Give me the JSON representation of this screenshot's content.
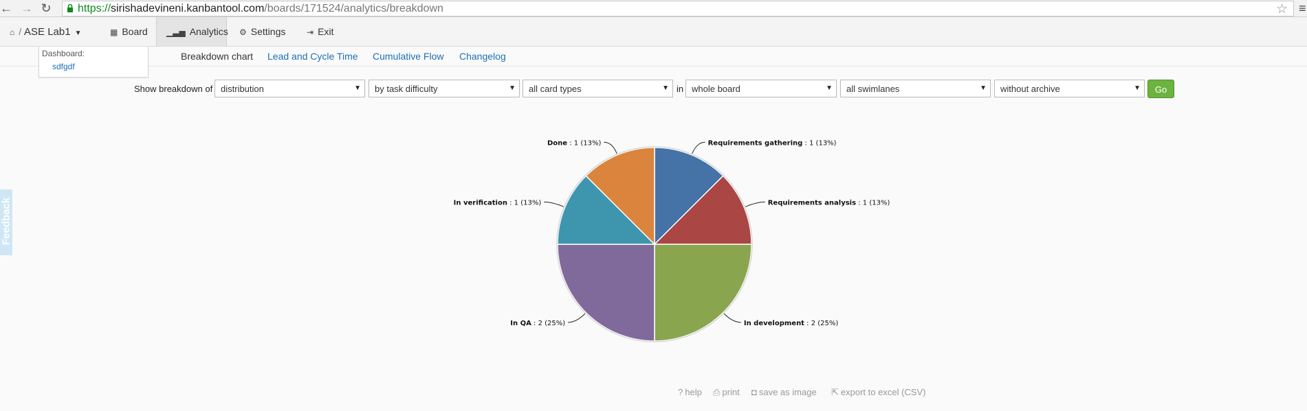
{
  "browser": {
    "url_scheme": "https://",
    "url_host": "sirishadevineni.kanbantool.com",
    "url_path": "/boards/171524/analytics/breakdown"
  },
  "app_nav": {
    "board_name": "ASE Lab1",
    "items": [
      {
        "label": "Board",
        "icon": "board-icon"
      },
      {
        "label": "Analytics",
        "icon": "chart-bars-icon",
        "active": true
      },
      {
        "label": "Settings",
        "icon": "gear-icon"
      },
      {
        "label": "Exit",
        "icon": "exit-icon"
      }
    ]
  },
  "dashboard": {
    "label": "Dashboard:",
    "link": "sdfgdf"
  },
  "subnav": {
    "current": "Breakdown chart",
    "links": [
      "Lead and Cycle Time",
      "Cumulative Flow",
      "Changelog"
    ]
  },
  "filters": {
    "show_label": "Show breakdown of",
    "in_label": "in",
    "selects": [
      "distribution",
      "by task difficulty",
      "all card types",
      "whole board",
      "all swimlanes",
      "without archive"
    ],
    "go_label": "Go",
    "go_color": "#6cb33f"
  },
  "chart_data": {
    "type": "pie",
    "slices": [
      {
        "label": "Requirements gathering",
        "value": 1,
        "pct": "13%",
        "color": "#4572a7"
      },
      {
        "label": "Requirements analysis",
        "value": 1,
        "pct": "13%",
        "color": "#aa4643"
      },
      {
        "label": "In development",
        "value": 2,
        "pct": "25%",
        "color": "#89a54e"
      },
      {
        "label": "In QA",
        "value": 2,
        "pct": "25%",
        "color": "#80699b"
      },
      {
        "label": "In verification",
        "value": 1,
        "pct": "13%",
        "color": "#3d96ae"
      },
      {
        "label": "Done",
        "value": 1,
        "pct": "13%",
        "color": "#db843d"
      }
    ]
  },
  "feedback": {
    "label": "Feedback"
  },
  "actions": [
    {
      "label": "help",
      "icon": "help-icon"
    },
    {
      "label": "print",
      "icon": "print-icon"
    },
    {
      "label": "save as image",
      "icon": "camera-icon"
    },
    {
      "label": "export to excel (CSV)",
      "icon": "export-icon"
    }
  ]
}
